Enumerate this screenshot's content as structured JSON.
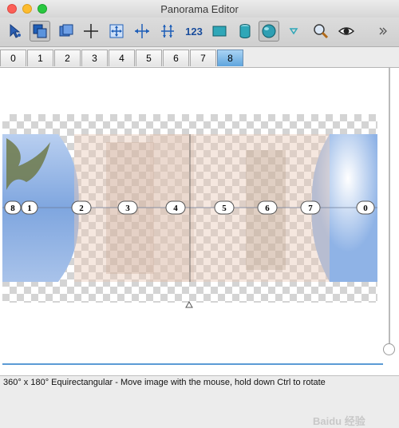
{
  "window": {
    "title": "Panorama Editor"
  },
  "toolbar": {
    "text_button": "123",
    "tools": [
      "select-arrow-icon",
      "image-overlay-icon",
      "image-stack-icon",
      "crosshair-icon",
      "move-expand-icon",
      "move-horizontal-icon",
      "stretch-vertical-icon",
      "numbers-tool",
      "rectangle-icon",
      "cylinder-icon",
      "sphere-icon",
      "dropdown-triangle-icon",
      "magnifier-icon",
      "eye-icon",
      "overflow-chevron-icon"
    ]
  },
  "tabs": [
    "0",
    "1",
    "2",
    "3",
    "4",
    "5",
    "6",
    "7",
    "8"
  ],
  "active_tab": "8",
  "image_labels": [
    "8",
    "1",
    "2",
    "3",
    "4",
    "5",
    "6",
    "7",
    "0"
  ],
  "status": {
    "text": "360° x 180° Equirectangular - Move image with the mouse, hold down Ctrl to rotate"
  },
  "watermark": {
    "text": "Baidu 经验"
  },
  "colors": {
    "active_tab": "#5fa5dd",
    "sky": "#7fa6df",
    "overlay": "#e8c9b8"
  }
}
